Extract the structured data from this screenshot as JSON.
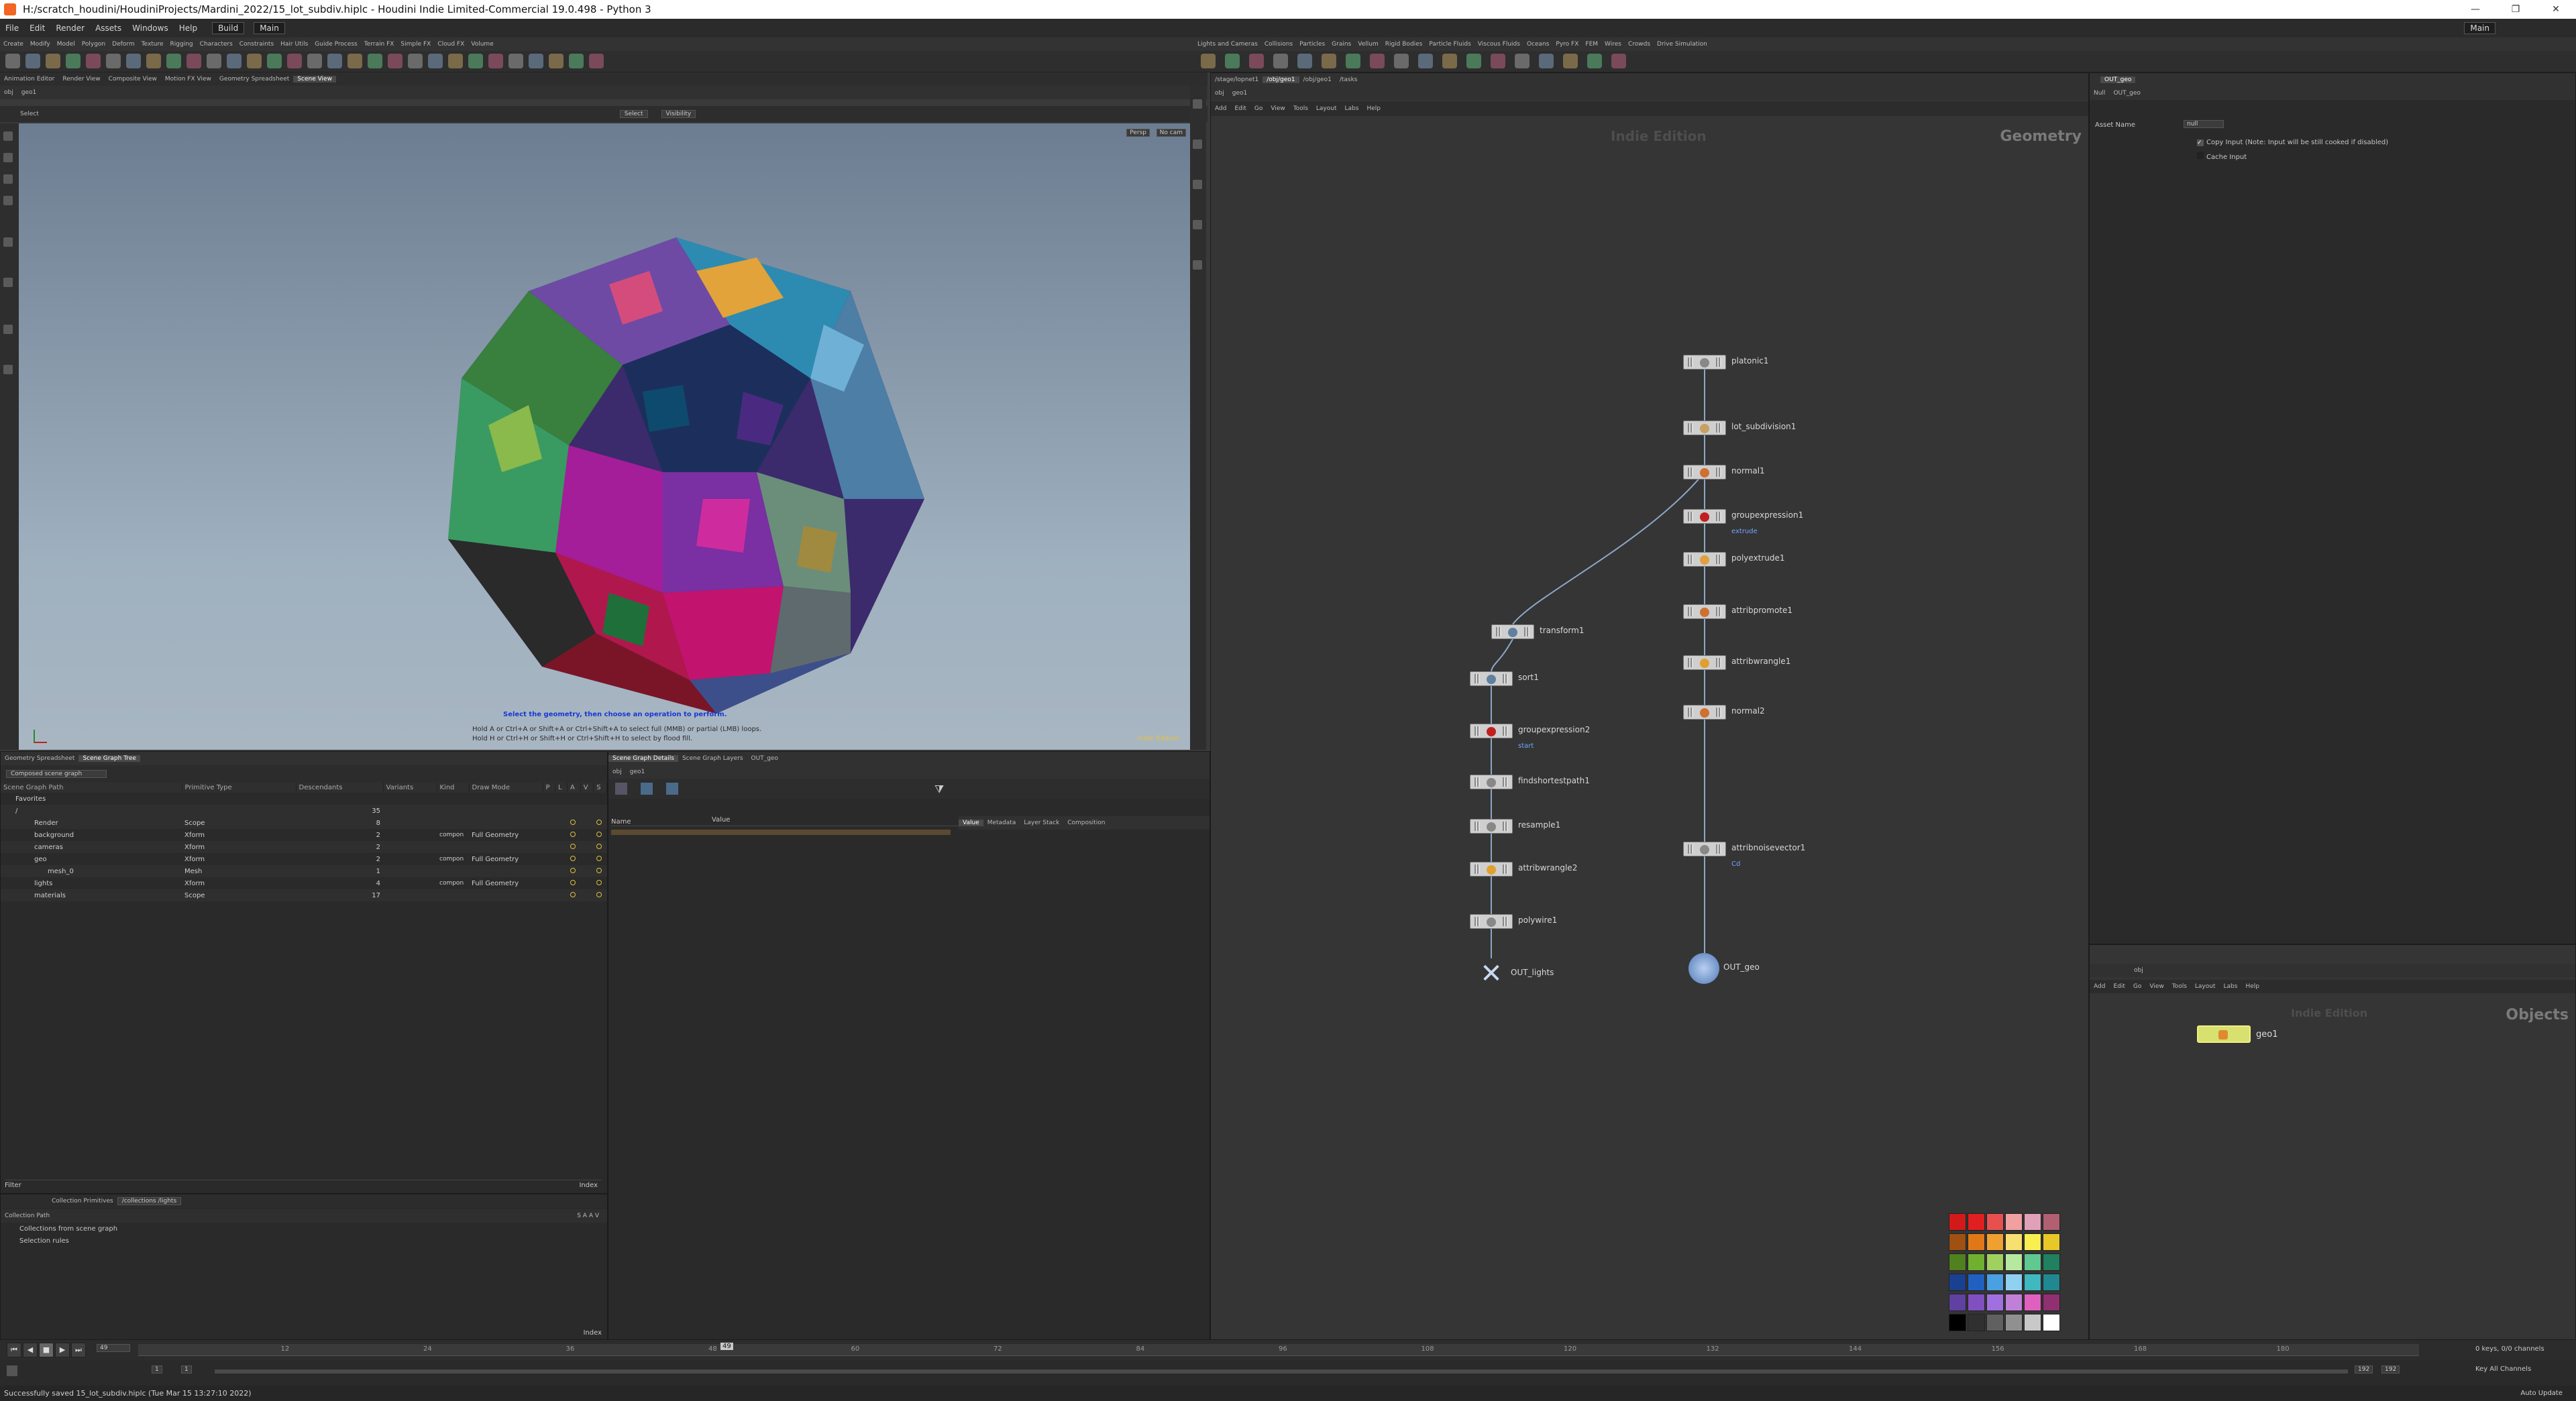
{
  "title": "H:/scratch_houdini/HoudiniProjects/Mardini_2022/15_lot_subdiv.hiplc - Houdini Indie Limited-Commercial 19.0.498 - Python 3",
  "window_controls": {
    "minimize": "—",
    "restore": "❐",
    "close": "✕"
  },
  "menubar": {
    "items": [
      "File",
      "Edit",
      "Render",
      "Assets",
      "Windows",
      "Help"
    ],
    "desktop_left": "Build",
    "desktop_right": "Main",
    "desktop_far": "Main"
  },
  "shelf_tabs_left": [
    "Create",
    "Modify",
    "Model",
    "Polygon",
    "Deform",
    "Texture",
    "Rigging",
    "Characters",
    "Constraints",
    "Hair Utils",
    "Guide Process",
    "Terrain FX",
    "Simple FX",
    "Cloud FX",
    "Volume"
  ],
  "shelf_tabs_right": [
    "Lights and Cameras",
    "Collisions",
    "Particles",
    "Grains",
    "Vellum",
    "Rigid Bodies",
    "Particle Fluids",
    "Viscous Fluids",
    "Oceans",
    "Pyro FX",
    "FEM",
    "Wires",
    "Crowds",
    "Drive Simulation"
  ],
  "scene_tabs": [
    "Animation Editor",
    "Render View",
    "Composite View",
    "Motion FX View",
    "Geometry Spreadsheet",
    "Scene View"
  ],
  "viewport": {
    "path_obj": "obj",
    "path_geo": "geo1",
    "select_label": "Select",
    "select_mode": "Select",
    "visibility": "Visibility",
    "persp": "Persp",
    "cam": "No cam",
    "hint_main": "Select the geometry, then choose an operation to perform.",
    "hint_line2": "Hold A or Ctrl+A or Shift+A or Ctrl+Shift+A to select full (MMB) or partial (LMB) loops.",
    "hint_line3": "Hold H or Ctrl+H or Shift+H or Ctrl+Shift+H to select by flood fill.",
    "corner_label": "Indie Edition"
  },
  "scenegraph": {
    "tabs": [
      "Geometry Spreadsheet",
      "Scene Graph Tree"
    ],
    "header_combo": "Composed scene graph",
    "columns": [
      "Scene Graph Path",
      "Primitive Type",
      "Descendants",
      "Variants",
      "Kind",
      "Draw Mode",
      "P",
      "L",
      "A",
      "V",
      "S"
    ],
    "favorites": "Favorites",
    "root": "/",
    "root_desc": "35",
    "rows": [
      {
        "name": "Render",
        "type": "Scope",
        "desc": "8",
        "kind": "",
        "draw": ""
      },
      {
        "name": "background",
        "type": "Xform",
        "desc": "2",
        "kind": "compon",
        "draw": "Full Geometry"
      },
      {
        "name": "cameras",
        "type": "Xform",
        "desc": "2",
        "kind": "",
        "draw": ""
      },
      {
        "name": "geo",
        "type": "Xform",
        "desc": "2",
        "kind": "compon",
        "draw": "Full Geometry"
      },
      {
        "name": "mesh_0",
        "type": "Mesh",
        "desc": "1",
        "kind": "",
        "draw": ""
      },
      {
        "name": "lights",
        "type": "Xform",
        "desc": "4",
        "kind": "compon",
        "draw": "Full Geometry"
      },
      {
        "name": "materials",
        "type": "Scope",
        "desc": "17",
        "kind": "",
        "draw": ""
      }
    ],
    "filter_label": "Filter",
    "index_label": "Index"
  },
  "collection": {
    "title": "Collection Primitives",
    "path": "/collections /lights",
    "col_header": "Collection Path",
    "col_flags": "S A A V",
    "items": [
      "Collections from scene graph",
      "Selection rules"
    ],
    "bottom": "Index"
  },
  "details": {
    "tabs": [
      "Scene Graph Details",
      "Scene Graph Layers",
      "OUT_geo"
    ],
    "path_obj": "obj",
    "path_geo": "geo1",
    "col_name": "Name",
    "col_value": "Value",
    "right_tabs": [
      "Value",
      "Metadata",
      "Layer Stack",
      "Composition"
    ]
  },
  "network": {
    "path": [
      "/stage/lopnet1",
      "/obj/geo1",
      "/obj/geo1",
      "/tasks"
    ],
    "inner_path_obj": "obj",
    "inner_path_geo": "geo1",
    "menu": [
      "Add",
      "Edit",
      "Go",
      "View",
      "Tools",
      "Layout",
      "Labs",
      "Help"
    ],
    "watermark": "Indie Edition",
    "context": "Geometry",
    "nodes": [
      {
        "name": "platonic1",
        "sub": ""
      },
      {
        "name": "lot_subdivision1",
        "sub": ""
      },
      {
        "name": "normal1",
        "sub": ""
      },
      {
        "name": "groupexpression1",
        "sub": "extrude"
      },
      {
        "name": "polyextrude1",
        "sub": ""
      },
      {
        "name": "attribpromote1",
        "sub": ""
      },
      {
        "name": "attribwrangle1",
        "sub": ""
      },
      {
        "name": "normal2",
        "sub": ""
      },
      {
        "name": "transform1",
        "sub": ""
      },
      {
        "name": "sort1",
        "sub": ""
      },
      {
        "name": "groupexpression2",
        "sub": "start"
      },
      {
        "name": "findshortestpath1",
        "sub": ""
      },
      {
        "name": "resample1",
        "sub": ""
      },
      {
        "name": "attribwrangle2",
        "sub": ""
      },
      {
        "name": "polywire1",
        "sub": ""
      },
      {
        "name": "attribnoisevector1",
        "sub": "Cd"
      },
      {
        "name": "OUT_lights",
        "sub": ""
      },
      {
        "name": "OUT_geo",
        "sub": ""
      }
    ]
  },
  "params": {
    "tab": "OUT_geo",
    "node_type": "Null",
    "node_name": "OUT_geo",
    "asset_name_label": "Asset Name",
    "asset_name_value": "null",
    "copy_input": "Copy Input (Note: Input will be still cooked if disabled)",
    "cache_input": "Cache Input"
  },
  "objects_net": {
    "path_obj": "obj",
    "menu": [
      "Add",
      "Edit",
      "Go",
      "View",
      "Tools",
      "Layout",
      "Labs",
      "Help"
    ],
    "watermark": "Indie Edition",
    "context": "Objects",
    "node": "geo1"
  },
  "palette_colors": [
    "#d31a1a",
    "#e02020",
    "#e85050",
    "#f0a0a0",
    "#e0a0b8",
    "#b06070",
    "#a05010",
    "#e07818",
    "#f0a030",
    "#f8e070",
    "#f8f050",
    "#e8c828",
    "#508020",
    "#70b030",
    "#a0d060",
    "#b8e8a0",
    "#60c890",
    "#208060",
    "#1a4090",
    "#2060c0",
    "#4aa0e0",
    "#90d0f0",
    "#40b8c0",
    "#208890",
    "#6040a0",
    "#8050c0",
    "#a070e0",
    "#c080d8",
    "#e060c0",
    "#903070",
    "#000000",
    "#303030",
    "#606060",
    "#909090",
    "#c8c8c8",
    "#ffffff"
  ],
  "timeline": {
    "frame": "49",
    "start": "1",
    "step": "1",
    "end": "192",
    "end2": "192",
    "ticks": [
      "12",
      "24",
      "36",
      "48",
      "60",
      "72",
      "84",
      "96",
      "108",
      "120",
      "132",
      "144",
      "156",
      "168",
      "180"
    ],
    "keys": "0 keys, 0/0 channels",
    "key_all": "Key All Channels",
    "auto_update": "Auto Update",
    "current": "49"
  },
  "status": "Successfully saved 15_lot_subdiv.hiplc (Tue Mar 15 13:27:10 2022)"
}
